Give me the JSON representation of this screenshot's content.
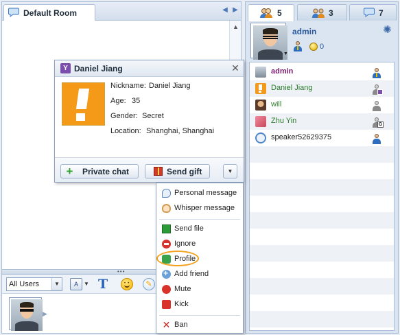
{
  "room": {
    "tab_label": "Default Room"
  },
  "input_toolbar": {
    "users_select_value": "All Users"
  },
  "right_tabs": [
    {
      "count": "5",
      "icon": "users-icon"
    },
    {
      "count": "3",
      "icon": "group-icon"
    },
    {
      "count": "7",
      "icon": "chat-bubble-icon"
    }
  ],
  "me": {
    "name": "admin",
    "coins": "0"
  },
  "users": [
    {
      "name": "admin",
      "color": "#7a1f6e",
      "bold": true,
      "role": "admin"
    },
    {
      "name": "Daniel Jiang",
      "color": "#2a7a2a",
      "bold": false,
      "role": "vip"
    },
    {
      "name": "will",
      "color": "#2a7a2a",
      "bold": false,
      "role": "guest"
    },
    {
      "name": "Zhu Yin",
      "color": "#2a7a2a",
      "bold": false,
      "role": "guest-g"
    },
    {
      "name": "speaker52629375",
      "color": "#222222",
      "bold": false,
      "role": "user"
    }
  ],
  "profile": {
    "title": "Daniel Jiang",
    "nickname_label": "Nickname:",
    "nickname": "Daniel Jiang",
    "age_label": "Age:",
    "age": "35",
    "gender_label": "Gender:",
    "gender": "Secret",
    "location_label": "Location:",
    "location": "Shanghai, Shanghai",
    "private_chat_label": "Private chat",
    "send_gift_label": "Send gift"
  },
  "context_menu": {
    "items": [
      "Personal message",
      "Whisper message",
      "Send file",
      "Ignore",
      "Profile",
      "Add friend",
      "Mute",
      "Kick",
      "Ban"
    ],
    "highlighted": "Profile"
  },
  "colors": {
    "accent": "#2a5aa0",
    "highlight_ring": "#f3a01a"
  }
}
